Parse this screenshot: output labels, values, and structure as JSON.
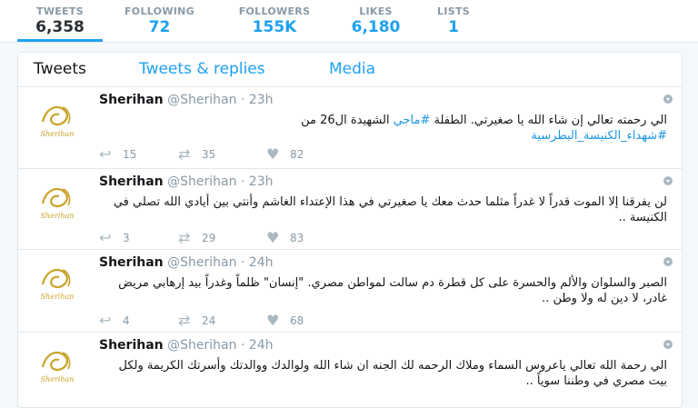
{
  "stats": [
    {
      "label": "TWEETS",
      "value": "6,358",
      "active": true
    },
    {
      "label": "FOLLOWING",
      "value": "72"
    },
    {
      "label": "FOLLOWERS",
      "value": "155K"
    },
    {
      "label": "LIKES",
      "value": "6,180"
    },
    {
      "label": "LISTS",
      "value": "1"
    }
  ],
  "tabs": [
    "Tweets",
    "Tweets & replies",
    "Media"
  ],
  "tweets": [
    {
      "name": "Sherihan",
      "handle": "@Sherihan",
      "sep": "·",
      "time": "23h",
      "line1": "الي رحمته تعالي إن شاء الله يا صغيرتي.  الطفلة ",
      "hashtag1": "#ماجي",
      "line1b": " الشهيدة ال26 من",
      "hashtag2": "#شهداء_الكنيسة_البطرسية",
      "replies": "15",
      "retweets": "35",
      "likes": "82"
    },
    {
      "name": "Sherihan",
      "handle": "@Sherihan",
      "sep": "·",
      "time": "23h",
      "text": "لن يفرقنا إلا الموت قدراً لا غدراً مثلما حدث معك يا صغيرتي في هذا الإعتداء الغاشم وأنتي بين أيادي الله تصلي في الكنيسة ..",
      "replies": "3",
      "retweets": "29",
      "likes": "83"
    },
    {
      "name": "Sherihan",
      "handle": "@Sherihan",
      "sep": "·",
      "time": "24h",
      "text": "الصبر والسلوان والألم والحسرة على كل قطرة دم سالت لمواطن مصري. \"إنسان\" ظلماً وغدراً بيد إرهابي مريض غادر، لا دين له ولا وطن ..",
      "replies": "4",
      "retweets": "24",
      "likes": "68"
    },
    {
      "name": "Sherihan",
      "handle": "@Sherihan",
      "sep": "·",
      "time": "24h",
      "text": "الي رحمة الله تعالي ياعروس السماء وملاك الرحمه لك الجنه ان شاء الله ولوالدك ووالدتك وأسرتك الكريمة ولكل بيت مصري في وطننا سوياً ..",
      "replies": "",
      "retweets": "",
      "likes": ""
    }
  ],
  "avatar_text": "Sherihan",
  "colors": {
    "accent": "#1da1f2",
    "muted": "#8899a6",
    "hashtag": "#1b95e0"
  }
}
